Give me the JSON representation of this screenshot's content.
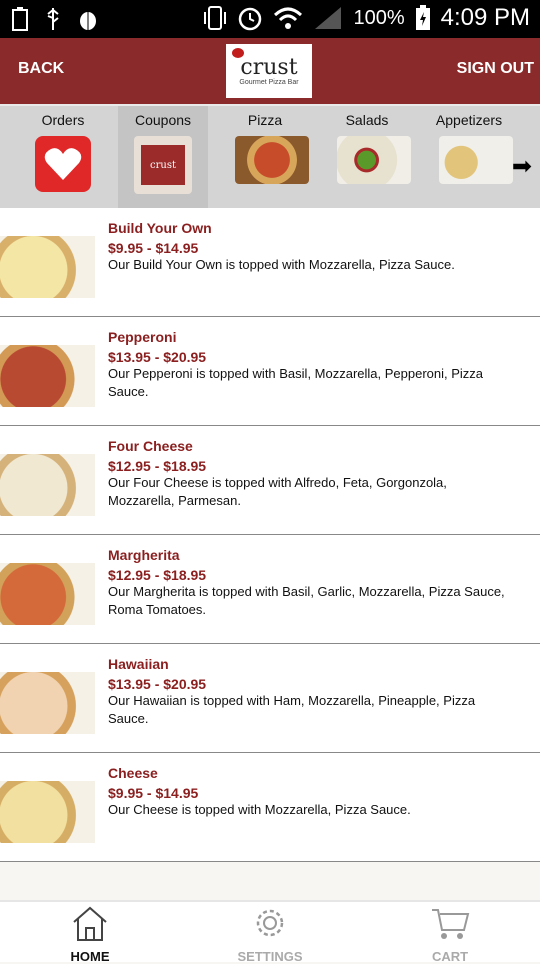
{
  "status_bar": {
    "battery_percent": "100%",
    "time": "4:09 PM"
  },
  "header": {
    "back_label": "BACK",
    "logo_word": "crust",
    "logo_tagline": "Gourmet Pizza Bar",
    "signout_label": "SIGN OUT"
  },
  "categories": [
    {
      "label": "Orders"
    },
    {
      "label": "Coupons",
      "coupon_text": "crust"
    },
    {
      "label": "Pizza"
    },
    {
      "label": "Salads"
    },
    {
      "label": "Appetizers"
    }
  ],
  "menu_items": [
    {
      "name": "Build Your Own",
      "price": "$9.95 - $14.95",
      "description": "Our Build Your Own is topped with Mozzarella, Pizza Sauce."
    },
    {
      "name": "Pepperoni",
      "price": "$13.95 - $20.95",
      "description": "Our Pepperoni is topped with Basil, Mozzarella, Pepperoni, Pizza Sauce."
    },
    {
      "name": "Four Cheese",
      "price": "$12.95 - $18.95",
      "description": "Our Four Cheese is topped with Alfredo, Feta, Gorgonzola, Mozzarella, Parmesan."
    },
    {
      "name": "Margherita",
      "price": "$12.95 - $18.95",
      "description": "Our Margherita is topped with Basil, Garlic, Mozzarella, Pizza Sauce, Roma Tomatoes."
    },
    {
      "name": "Hawaiian",
      "price": "$13.95 - $20.95",
      "description": "Our Hawaiian is topped with Ham, Mozzarella, Pineapple, Pizza Sauce."
    },
    {
      "name": "Cheese",
      "price": "$9.95 - $14.95",
      "description": "Our Cheese is topped with Mozzarella, Pizza Sauce."
    }
  ],
  "bottom_nav": {
    "home": "HOME",
    "settings": "SETTINGS",
    "cart": "CART"
  },
  "colors": {
    "brand": "#8b2a2a",
    "accent_text": "#8b1f1f",
    "category_bar": "#d4d4d4"
  }
}
